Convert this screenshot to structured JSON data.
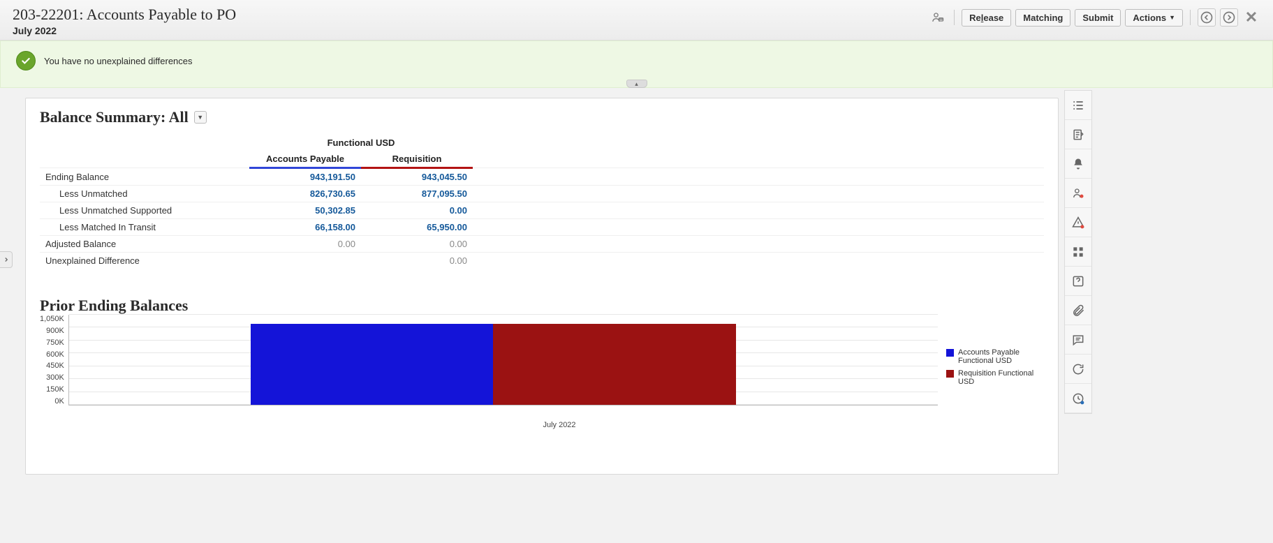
{
  "header": {
    "title": "203-22201: Accounts Payable to PO",
    "subtitle": "July 2022",
    "buttons": {
      "release_prefix": "Re",
      "release_suffix": "ease",
      "release_u": "l",
      "matching": "Matching",
      "submit": "Submit",
      "actions": "Actions"
    }
  },
  "banner": {
    "text": "You have no unexplained differences"
  },
  "balance": {
    "title_prefix": "Balance Summary: ",
    "title_scope": "All",
    "group_header": "Functional USD",
    "col_a": "Accounts Payable",
    "col_b": "Requisition",
    "rows": [
      {
        "label": "Ending Balance",
        "indent": false,
        "a": "943,191.50",
        "b": "943,045.50",
        "style": "link"
      },
      {
        "label": "Less Unmatched",
        "indent": true,
        "a": "826,730.65",
        "b": "877,095.50",
        "style": "link"
      },
      {
        "label": "Less Unmatched Supported",
        "indent": true,
        "a": "50,302.85",
        "b": "0.00",
        "style": "link"
      },
      {
        "label": "Less Matched In Transit",
        "indent": true,
        "a": "66,158.00",
        "b": "65,950.00",
        "style": "link"
      },
      {
        "label": "Adjusted Balance",
        "indent": false,
        "a": "0.00",
        "b": "0.00",
        "style": "grey"
      },
      {
        "label": "Unexplained Difference",
        "indent": false,
        "a": "",
        "b": "0.00",
        "style": "grey"
      }
    ]
  },
  "chart": {
    "title": "Prior Ending Balances",
    "y_ticks": [
      "1,050K",
      "900K",
      "750K",
      "600K",
      "450K",
      "300K",
      "150K",
      "0K"
    ],
    "x_label": "July 2022",
    "legend": [
      {
        "name": "Accounts Payable Functional USD",
        "color": "#1414d8"
      },
      {
        "name": "Requisition Functional USD",
        "color": "#9b1212"
      }
    ]
  },
  "chart_data": {
    "type": "bar",
    "categories": [
      "July 2022"
    ],
    "series": [
      {
        "name": "Accounts Payable Functional USD",
        "values": [
          943191.5
        ],
        "color": "#1414d8"
      },
      {
        "name": "Requisition Functional USD",
        "values": [
          943045.5
        ],
        "color": "#9b1212"
      }
    ],
    "ylim": [
      0,
      1050000
    ],
    "y_unit": "thousands",
    "xlabel": "",
    "ylabel": ""
  }
}
